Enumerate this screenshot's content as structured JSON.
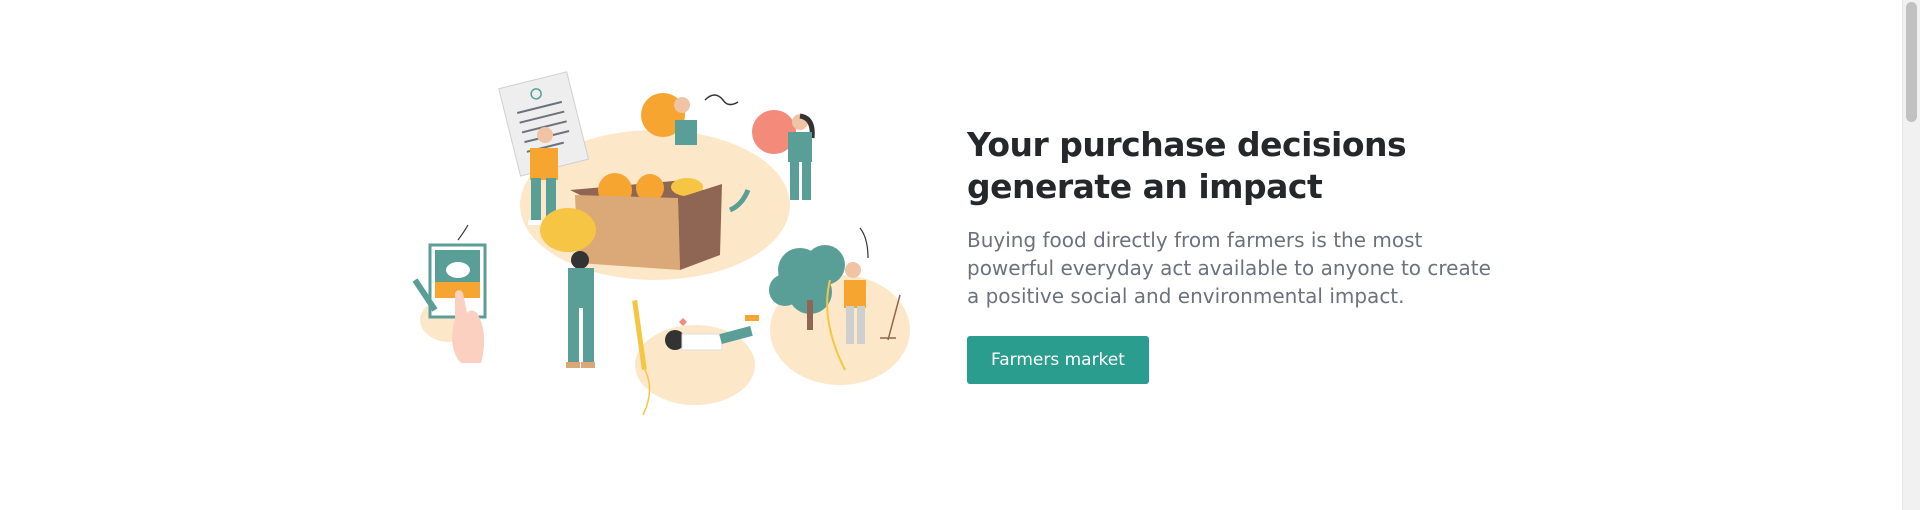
{
  "hero": {
    "title": "Your purchase decisions generate an impact",
    "description": "Buying food directly from farmers is the most powerful everyday act available to anyone to create a positive social and environmental impact.",
    "cta_label": "Farmers market",
    "illustration_icon": "farmers-produce-illustration"
  },
  "colors": {
    "accent": "#2a9d8f",
    "title": "#24282b",
    "text": "#6c727d",
    "blob": "#fde7c9",
    "orange": "#f6a531",
    "teal": "#5a9e98",
    "box": "#d9a876"
  }
}
